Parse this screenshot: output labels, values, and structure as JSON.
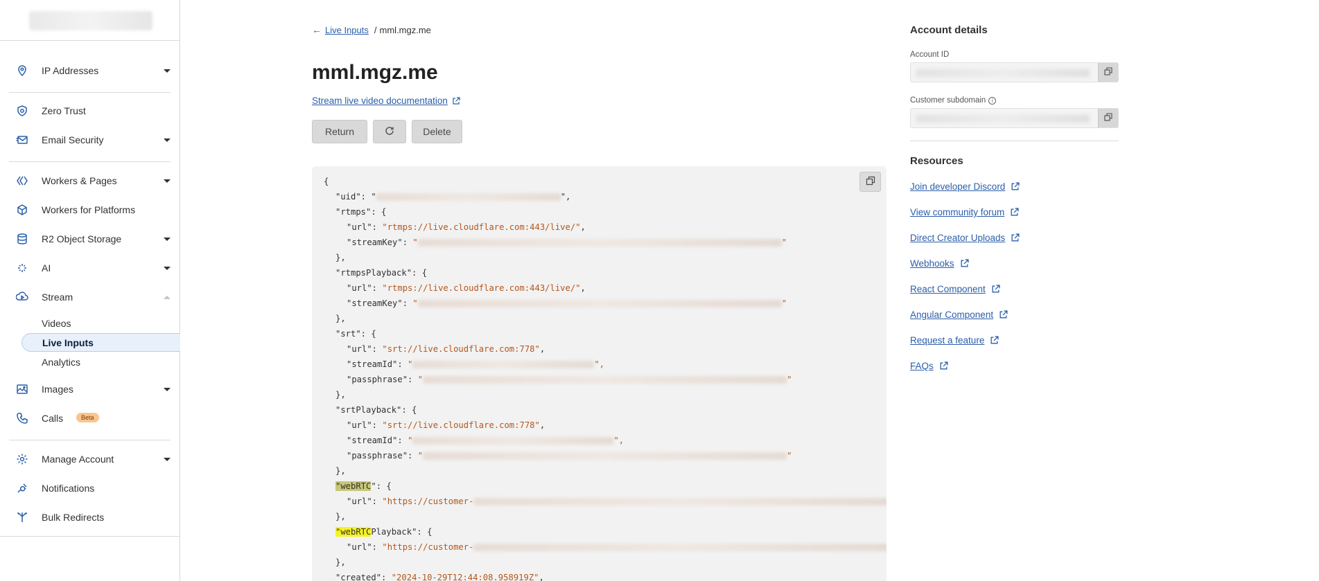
{
  "sidebar": {
    "items": [
      {
        "label": "IP Addresses",
        "icon": "location-pin-icon",
        "caret": "down"
      },
      {
        "label": "Zero Trust",
        "icon": "zero-trust-shield-icon"
      },
      {
        "label": "Email Security",
        "icon": "email-icon",
        "caret": "down"
      },
      {
        "label": "Workers & Pages",
        "icon": "workers-icon",
        "caret": "down"
      },
      {
        "label": "Workers for Platforms",
        "icon": "workers-platforms-icon"
      },
      {
        "label": "R2 Object Storage",
        "icon": "database-icon",
        "caret": "down"
      },
      {
        "label": "AI",
        "icon": "sparkles-icon",
        "caret": "down"
      },
      {
        "label": "Stream",
        "icon": "stream-icon",
        "caret": "up"
      },
      {
        "label": "Images",
        "icon": "image-icon",
        "caret": "down"
      },
      {
        "label": "Calls",
        "icon": "phone-icon",
        "badge": "Beta"
      },
      {
        "label": "Manage Account",
        "icon": "gear-icon",
        "caret": "down"
      },
      {
        "label": "Notifications",
        "icon": "notifications-icon"
      },
      {
        "label": "Bulk Redirects",
        "icon": "redirects-icon"
      }
    ],
    "stream_sub": [
      "Videos",
      "Live Inputs",
      "Analytics"
    ],
    "active_sub": "Live Inputs"
  },
  "breadcrumb": {
    "parent": "Live Inputs",
    "separator": "/",
    "current": "mml.mgz.me"
  },
  "page": {
    "title": "mml.mgz.me",
    "doc_link": "Stream live video documentation",
    "buttons": {
      "return": "Return",
      "delete": "Delete"
    }
  },
  "code": {
    "l1": "{",
    "uid_key": "\"uid\": \"",
    "uid_end": "\",",
    "rtmps_open": "\"rtmps\": {",
    "url_key": "\"url\": ",
    "rtmps_url": "\"rtmps://live.cloudflare.com:443/live/\"",
    "comma": ",",
    "streamkey_key": "\"streamKey\": ",
    "quote": "\"",
    "close_comma": "},",
    "rtmpsplayback_open": "\"rtmpsPlayback\": {",
    "srt_open": "\"srt\": {",
    "srt_url": "\"srt://live.cloudflare.com:778\"",
    "streamid_key": "\"streamId\": ",
    "quote_comma": "\",",
    "passphrase_key": "\"passphrase\": ",
    "srtplayback_open": "\"srtPlayback\": {",
    "webrtc_hl": "\"webRTC",
    "webrtc_rest": "\": {",
    "webrtc_url_prefix": "\"https://customer-",
    "webrtcplayback_rest": "Playback\": {",
    "created_key": "\"created\": ",
    "created_val": "\"2024-10-29T12:44:08.958919Z\""
  },
  "right": {
    "account_title": "Account details",
    "account_id_label": "Account ID",
    "subdomain_label": "Customer subdomain",
    "resources_title": "Resources",
    "links": [
      "Join developer Discord",
      "View community forum",
      "Direct Creator Uploads",
      "Webhooks",
      "React Component",
      "Angular Component",
      "Request a feature",
      "FAQs"
    ]
  },
  "colors": {
    "link": "#2a5ea8",
    "code_string": "#b5561a",
    "highlight_current": "#c8c777",
    "highlight_match": "#f6f322",
    "beta_badge": "#f9c58f"
  }
}
